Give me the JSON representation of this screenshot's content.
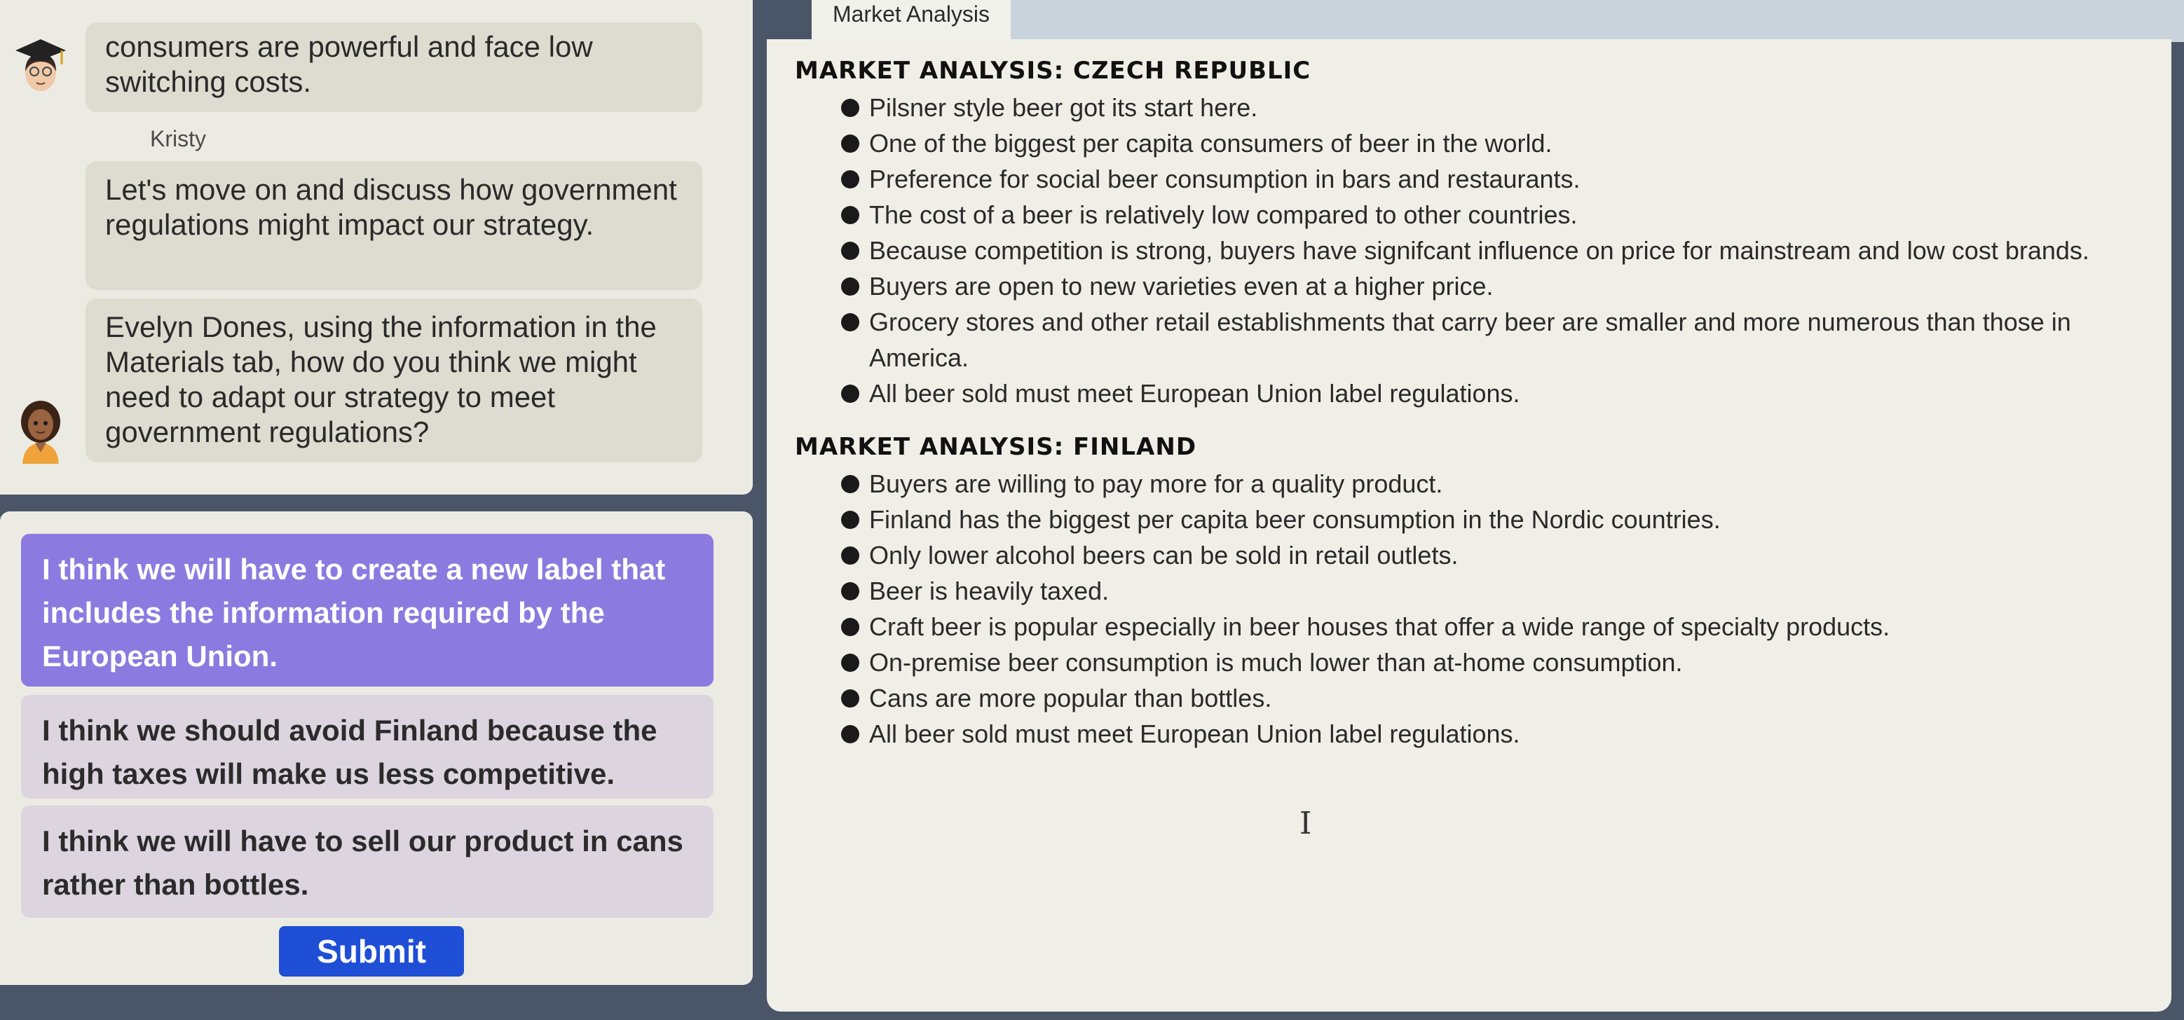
{
  "chat": {
    "messages": [
      {
        "text": "consumers are powerful and face low switching costs."
      },
      {
        "speaker": "Kristy",
        "text": "Let's move on and discuss how government regulations might impact our strategy."
      },
      {
        "text": "Evelyn Dones, using the information in the Materials tab, how do you think we might need to adapt our strategy to meet government regulations?"
      }
    ]
  },
  "answers": {
    "options": [
      {
        "text": "I think we will have to create a new label that includes the information required by the European Union.",
        "selected": true
      },
      {
        "text": "I think we should avoid Finland because the high taxes will make us less competitive.",
        "selected": false
      },
      {
        "text": "I think we will have to sell our product in cans rather than bottles.",
        "selected": false
      }
    ],
    "submit_label": "Submit"
  },
  "materials": {
    "tab_label": "Market Analysis",
    "sections": [
      {
        "heading": "MARKET ANALYSIS: CZECH REPUBLIC",
        "bullets": [
          "Pilsner style beer got its start here.",
          "One of the biggest per capita consumers of beer in the world.",
          "Preference for social beer consumption in bars and restaurants.",
          "The cost of a beer is relatively low compared to other countries.",
          "Because competition is strong, buyers have signifcant influence on price for mainstream and low cost brands.",
          "Buyers are open to new varieties even at a higher price.",
          "Grocery stores and other retail establishments that carry beer are smaller and more numerous than those in America.",
          "All beer sold must meet European Union label regulations."
        ]
      },
      {
        "heading": "MARKET ANALYSIS: FINLAND",
        "bullets": [
          "Buyers are willing to pay more for a quality product.",
          "Finland has the biggest per capita beer consumption in the Nordic countries.",
          "Only lower alcohol beers can be sold in retail outlets.",
          "Beer is heavily taxed.",
          "Craft beer is popular especially in beer houses that offer a wide range of specialty products.",
          "On-premise beer consumption is much lower than at-home consumption.",
          "Cans are more popular than bottles.",
          "All beer sold must meet European Union label regulations."
        ]
      }
    ]
  },
  "colors": {
    "selected_option": "#8b7be0",
    "submit_button": "#1f4fd6",
    "panel_background": "#efefe7"
  },
  "icons": [
    "graduate-avatar-icon",
    "evelyn-avatar-icon",
    "bullet-icon",
    "text-cursor-icon"
  ]
}
